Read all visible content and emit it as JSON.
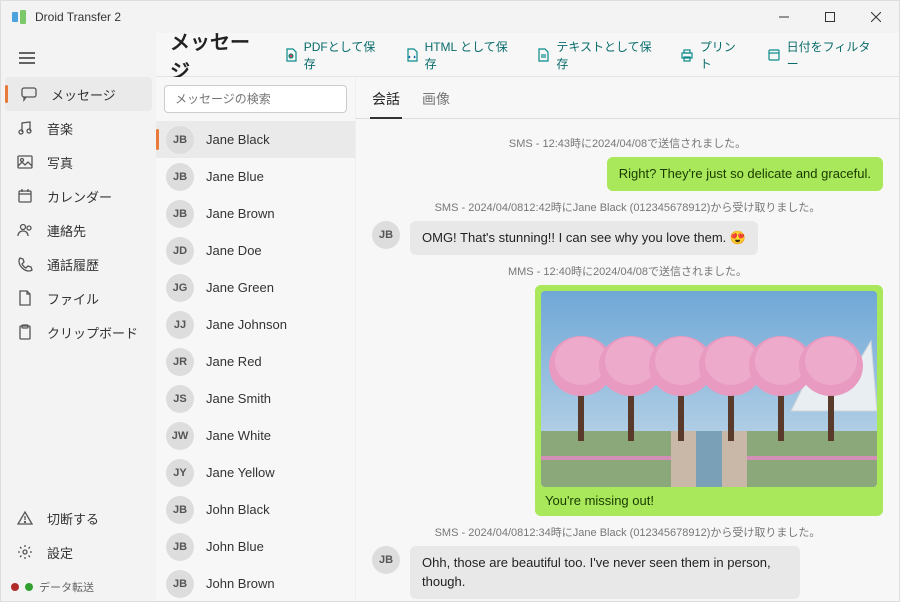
{
  "app": {
    "title": "Droid Transfer 2"
  },
  "nav": {
    "items": [
      {
        "label": "メッセージ",
        "icon": "message",
        "active": true
      },
      {
        "label": "音楽",
        "icon": "music"
      },
      {
        "label": "写真",
        "icon": "photo"
      },
      {
        "label": "カレンダー",
        "icon": "calendar"
      },
      {
        "label": "連絡先",
        "icon": "contacts"
      },
      {
        "label": "通話履歴",
        "icon": "phone"
      },
      {
        "label": "ファイル",
        "icon": "file"
      },
      {
        "label": "クリップボード",
        "icon": "clipboard"
      }
    ],
    "footer": [
      {
        "label": "切断する",
        "icon": "warning"
      },
      {
        "label": "設定",
        "icon": "gear"
      }
    ],
    "status": "データ転送"
  },
  "header": {
    "title": "メッセージ",
    "buttons": [
      {
        "label": "PDFとして保存",
        "icon": "pdf"
      },
      {
        "label": "HTML として保存",
        "icon": "html"
      },
      {
        "label": "テキストとして保存",
        "icon": "text"
      },
      {
        "label": "プリント",
        "icon": "print"
      },
      {
        "label": "日付をフィルター",
        "icon": "filter"
      }
    ]
  },
  "search": {
    "placeholder": "メッセージの検索"
  },
  "conversations": [
    {
      "initials": "JB",
      "name": "Jane Black",
      "active": true
    },
    {
      "initials": "JB",
      "name": "Jane Blue"
    },
    {
      "initials": "JB",
      "name": "Jane Brown"
    },
    {
      "initials": "JD",
      "name": "Jane Doe"
    },
    {
      "initials": "JG",
      "name": "Jane Green"
    },
    {
      "initials": "JJ",
      "name": "Jane Johnson"
    },
    {
      "initials": "JR",
      "name": "Jane Red"
    },
    {
      "initials": "JS",
      "name": "Jane Smith"
    },
    {
      "initials": "JW",
      "name": "Jane White"
    },
    {
      "initials": "JY",
      "name": "Jane Yellow"
    },
    {
      "initials": "JB",
      "name": "John Black"
    },
    {
      "initials": "JB",
      "name": "John Blue"
    },
    {
      "initials": "JB",
      "name": "John Brown"
    }
  ],
  "tabs": [
    {
      "label": "会話",
      "active": true
    },
    {
      "label": "画像"
    }
  ],
  "messages": [
    {
      "kind": "meta",
      "text": "SMS - 12:43時に2024/04/08で送信されました。"
    },
    {
      "kind": "out",
      "text": "Right? They're just so delicate and graceful."
    },
    {
      "kind": "meta",
      "text": "SMS - 2024/04/0812:42時にJane Black (012345678912)から受け取りました。"
    },
    {
      "kind": "in",
      "initials": "JB",
      "text": "OMG! That's stunning!! I can see why you love them. 😍"
    },
    {
      "kind": "meta",
      "text": "MMS - 12:40時に2024/04/08で送信されました。"
    },
    {
      "kind": "mms-out",
      "caption": "You're missing out!"
    },
    {
      "kind": "meta",
      "text": "SMS - 2024/04/0812:34時にJane Black (012345678912)から受け取りました。"
    },
    {
      "kind": "in",
      "initials": "JB",
      "text": "Ohh, those are beautiful too. I've never seen them in person, though."
    }
  ]
}
